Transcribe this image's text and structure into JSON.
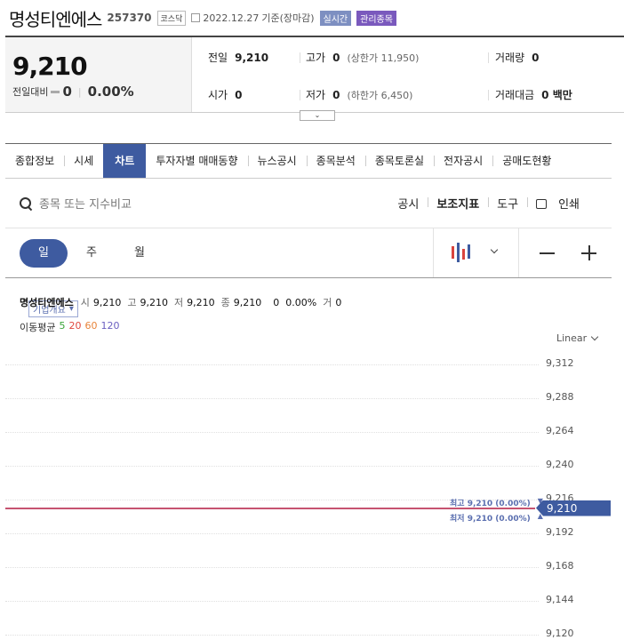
{
  "header": {
    "company": "명성티엔에스",
    "code": "257370",
    "market": "코스닥",
    "date": "2022.12.27",
    "basis": "기준(장마감)",
    "live_label": "실시간",
    "company_info_label": "기업개요",
    "mgmt_label": "관리종목"
  },
  "price": {
    "current": "9,210",
    "change_label": "전일대비",
    "change_value": "0",
    "change_pct": "0.00%",
    "prev_label": "전일",
    "prev_value": "9,210",
    "high_label": "고가",
    "high_value": "0",
    "upper_limit": "(상한가 11,950)",
    "volume_label": "거래량",
    "volume_value": "0",
    "open_label": "시가",
    "open_value": "0",
    "low_label": "저가",
    "low_value": "0",
    "lower_limit": "(하한가 6,450)",
    "amount_label": "거래대금",
    "amount_value": "0 백만"
  },
  "tabs": [
    "종합정보",
    "시세",
    "차트",
    "투자자별 매매동향",
    "뉴스공시",
    "종목분석",
    "종목토론실",
    "전자공시",
    "공매도현황"
  ],
  "search": {
    "placeholder": "종목 또는 지수비교"
  },
  "tools": {
    "disclosure": "공시",
    "indicator": "보조지표",
    "tool": "도구",
    "print": "인쇄"
  },
  "periods": [
    "일",
    "주",
    "월"
  ],
  "chart_info": {
    "name": "명성티엔에스",
    "open_k": "시",
    "open_v": "9,210",
    "high_k": "고",
    "high_v": "9,210",
    "low_k": "저",
    "low_v": "9,210",
    "close_k": "종",
    "close_v": "9,210",
    "chg": "0",
    "chg_pct": "0.00%",
    "vol_k": "거",
    "vol_v": "0",
    "ma_label": "이동평균",
    "ma": [
      {
        "label": "5",
        "color": "#3aa53a"
      },
      {
        "label": "20",
        "color": "#e0483e"
      },
      {
        "label": "60",
        "color": "#e8843a"
      },
      {
        "label": "120",
        "color": "#6a5fc0"
      }
    ],
    "scale": "Linear"
  },
  "chart_data": {
    "type": "line",
    "y_ticks": [
      "9,312",
      "9,288",
      "9,264",
      "9,240",
      "9,216",
      "9,192",
      "9,168",
      "9,144",
      "9,120"
    ],
    "ylim": [
      9120,
      9312
    ],
    "current_price": 9210,
    "current_label": "9,210",
    "high_text": "최고 9,210 (0.00%)",
    "low_text": "최저 9,210 (0.00%)",
    "colors": {
      "accent": "#3e5ba0",
      "price_line": "#c04060",
      "mgmt": "#7a59bd"
    }
  }
}
